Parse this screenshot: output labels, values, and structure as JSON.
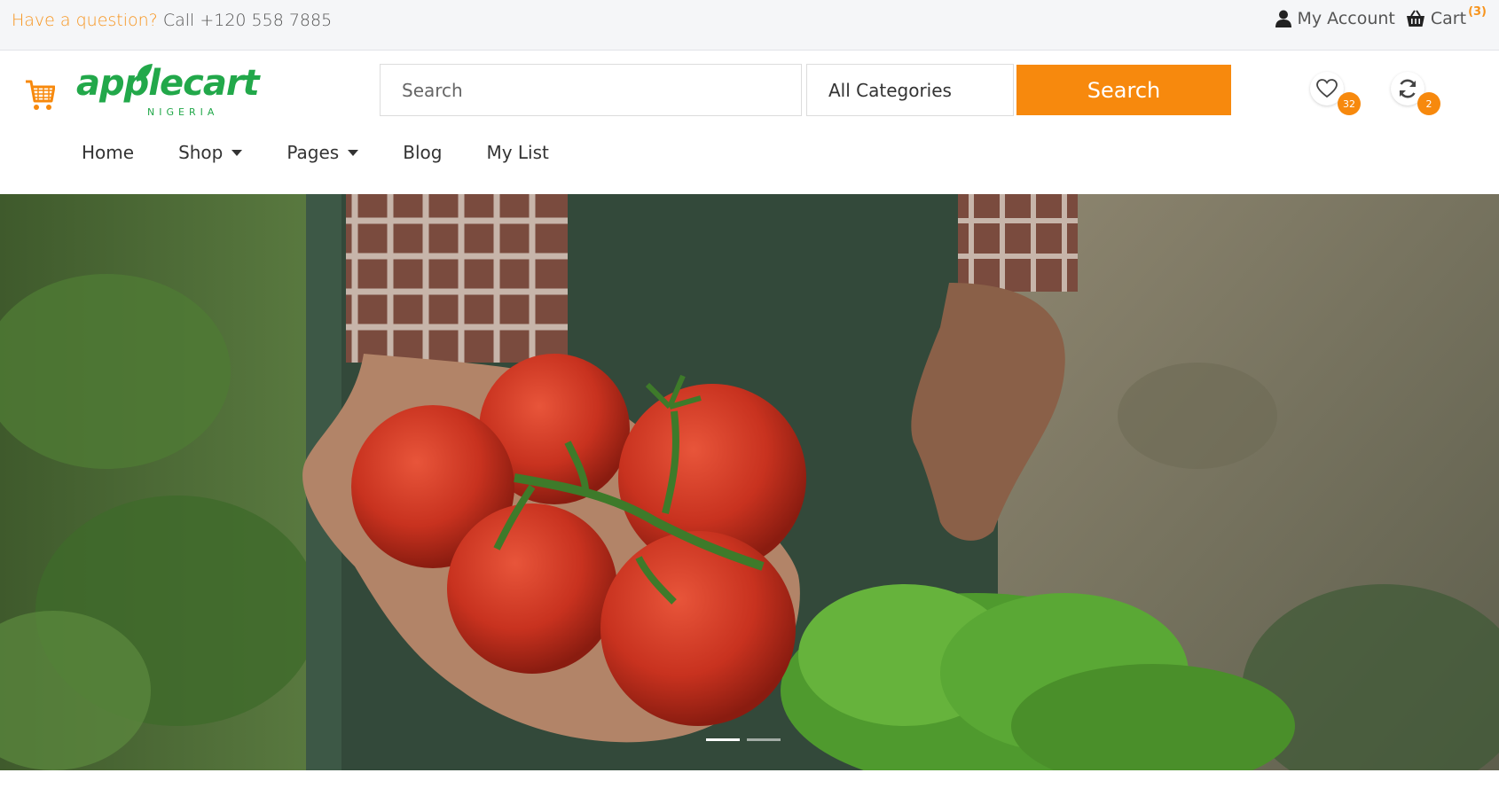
{
  "topbar": {
    "question_label": "Have a question?",
    "phone_label": "Call +120 558 7885",
    "account_label": "My Account",
    "cart_label": "Cart",
    "cart_count": "(3)"
  },
  "logo": {
    "word_apple": "apple",
    "word_cart": "cart",
    "sub": "NIGERIA"
  },
  "search": {
    "placeholder": "Search",
    "category_selected": "All Categories",
    "button_label": "Search"
  },
  "icons": {
    "wishlist_count": "32",
    "compare_count": "2"
  },
  "nav": {
    "items": [
      "Home",
      "Shop",
      "Pages",
      "Blog",
      "My List"
    ]
  },
  "hero": {
    "slide_count": 2,
    "active_slide": 1
  },
  "colors": {
    "accent": "#f7890d",
    "brand_green": "#22a84a",
    "topbar_bg": "#f5f6f8"
  }
}
